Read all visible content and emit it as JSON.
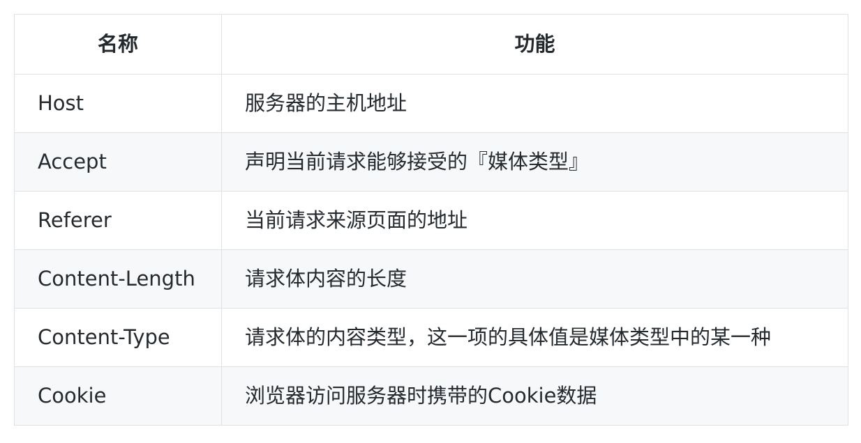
{
  "table": {
    "headers": [
      "名称",
      "功能"
    ],
    "rows": [
      {
        "name": "Host",
        "function": "服务器的主机地址"
      },
      {
        "name": "Accept",
        "function": "声明当前请求能够接受的『媒体类型』"
      },
      {
        "name": "Referer",
        "function": "当前请求来源页面的地址"
      },
      {
        "name": "Content-Length",
        "function": "请求体内容的长度"
      },
      {
        "name": "Content-Type",
        "function": "请求体的内容类型，这一项的具体值是媒体类型中的某一种"
      },
      {
        "name": "Cookie",
        "function": "浏览器访问服务器时携带的Cookie数据"
      }
    ]
  }
}
